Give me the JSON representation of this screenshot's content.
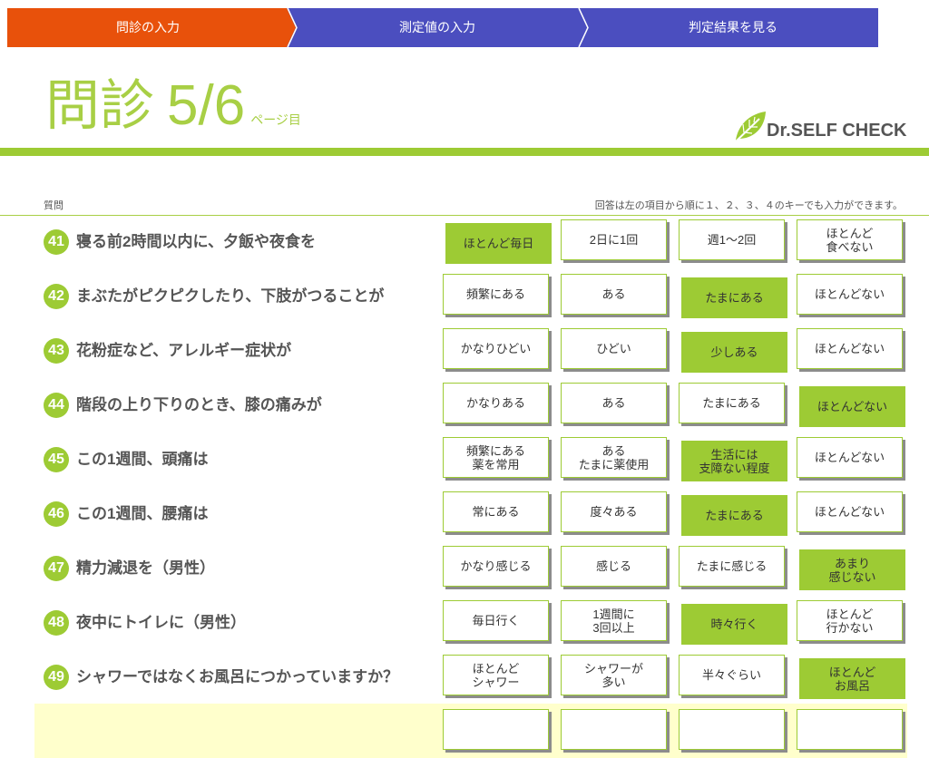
{
  "steps": {
    "items": [
      {
        "label": "問診の入力"
      },
      {
        "label": "測定値の入力"
      },
      {
        "label": "判定結果を見る"
      }
    ],
    "current_index": 0
  },
  "colors": {
    "accent_green": "#9DCB34",
    "step_current": "#E8510B",
    "step_other": "#4B4EBF",
    "focus_row": "#FFFFCC",
    "title_green": "#A8CF45"
  },
  "header": {
    "title": "問診",
    "page": "5/6",
    "page_suffix": "ページ目"
  },
  "logo": {
    "text": "Dr.SELF CHECK",
    "icon": "leaf-icon"
  },
  "table": {
    "question_column": "質問",
    "hint": "回答は左の項目から順に１、２、３、４のキーでも入力ができます。"
  },
  "questions": [
    {
      "number": "41",
      "text": "寝る前2時間以内に、夕飯や夜食を",
      "options": [
        "ほとんど毎日",
        "2日に1回",
        "週1〜2回",
        "ほとんど\n食べない"
      ],
      "selected": 0
    },
    {
      "number": "42",
      "text": "まぶたがピクピクしたり、下肢がつることが",
      "options": [
        "頻繁にある",
        "ある",
        "たまにある",
        "ほとんどない"
      ],
      "selected": 2
    },
    {
      "number": "43",
      "text": "花粉症など、アレルギー症状が",
      "options": [
        "かなりひどい",
        "ひどい",
        "少しある",
        "ほとんどない"
      ],
      "selected": 2
    },
    {
      "number": "44",
      "text": "階段の上り下りのとき、膝の痛みが",
      "options": [
        "かなりある",
        "ある",
        "たまにある",
        "ほとんどない"
      ],
      "selected": 3
    },
    {
      "number": "45",
      "text": "この1週間、頭痛は",
      "options": [
        "頻繁にある\n薬を常用",
        "ある\nたまに薬使用",
        "生活には\n支障ない程度",
        "ほとんどない"
      ],
      "selected": 2
    },
    {
      "number": "46",
      "text": "この1週間、腰痛は",
      "options": [
        "常にある",
        "度々ある",
        "たまにある",
        "ほとんどない"
      ],
      "selected": 2
    },
    {
      "number": "47",
      "text": "精力減退を（男性）",
      "options": [
        "かなり感じる",
        "感じる",
        "たまに感じる",
        "あまり\n感じない"
      ],
      "selected": 3
    },
    {
      "number": "48",
      "text": "夜中にトイレに（男性）",
      "options": [
        "毎日行く",
        "1週間に\n3回以上",
        "時々行く",
        "ほとんど\n行かない"
      ],
      "selected": 2
    },
    {
      "number": "49",
      "text": "シャワーではなくお風呂につかっていますか？",
      "options": [
        "ほとんど\nシャワー",
        "シャワーが\n多い",
        "半々ぐらい",
        "ほとんど\nお風呂"
      ],
      "selected": 3
    }
  ]
}
